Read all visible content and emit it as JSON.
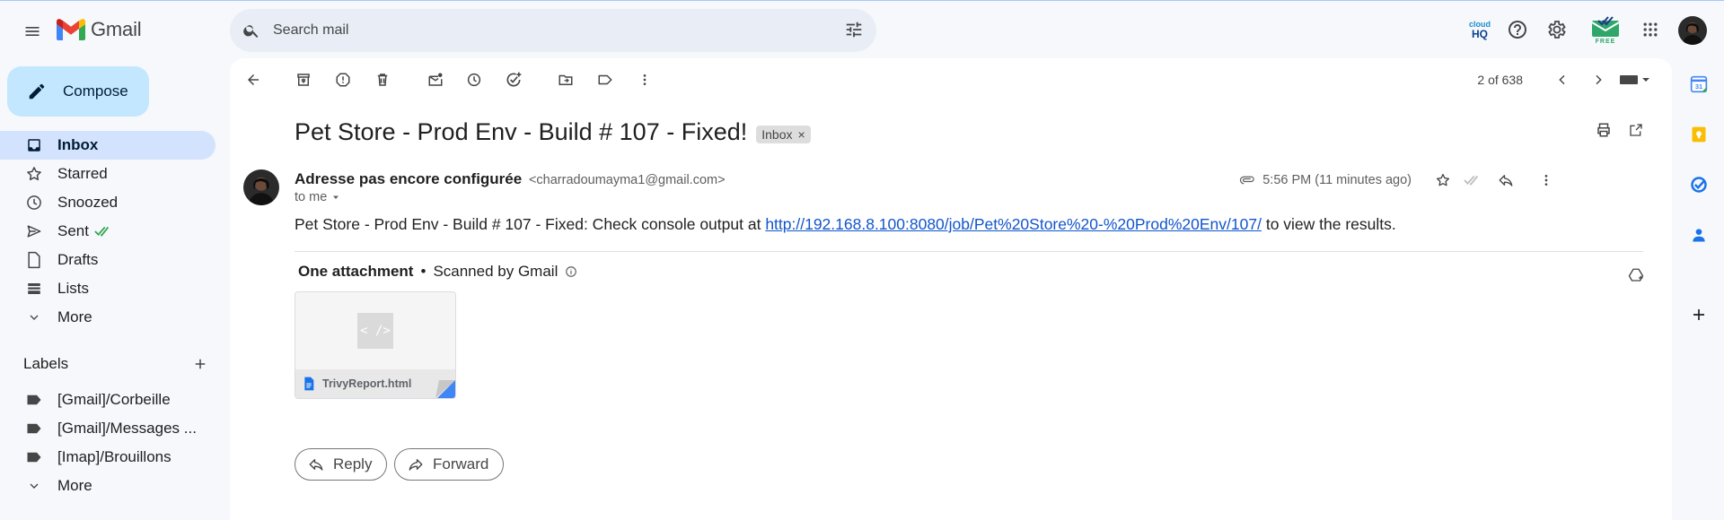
{
  "app": {
    "name": "Gmail"
  },
  "search": {
    "placeholder": "Search mail"
  },
  "header_right": {
    "addon_badge": "FREE"
  },
  "compose": {
    "label": "Compose"
  },
  "nav": {
    "items": [
      {
        "label": "Inbox",
        "icon": "inbox-icon",
        "active": true
      },
      {
        "label": "Starred",
        "icon": "star-icon"
      },
      {
        "label": "Snoozed",
        "icon": "clock-icon"
      },
      {
        "label": "Sent",
        "icon": "send-icon"
      },
      {
        "label": "Drafts",
        "icon": "draft-icon"
      },
      {
        "label": "Lists",
        "icon": "list-icon"
      },
      {
        "label": "More",
        "icon": "chevron-down-icon"
      }
    ]
  },
  "labels": {
    "heading": "Labels",
    "items": [
      {
        "label": "[Gmail]/Corbeille"
      },
      {
        "label": "[Gmail]/Messages ..."
      },
      {
        "label": "[Imap]/Brouillons"
      },
      {
        "label": "More"
      }
    ]
  },
  "toolbar": {
    "paging": "2 of 638"
  },
  "email": {
    "subject": "Pet Store - Prod Env - Build # 107 - Fixed!",
    "label_chip": "Inbox",
    "chip_close": "×",
    "sender_name": "Adresse pas encore configurée",
    "sender_email": "<charradoumayma1@gmail.com>",
    "to": "to me",
    "time": "5:56 PM (11 minutes ago)",
    "body_prefix": "Pet Store - Prod Env - Build # 107 - Fixed: Check console output at",
    "body_link": "http://192.168.8.100:8080/job/Pet%20Store%20-%20Prod%20Env/107/",
    "body_suffix": "to view the results.",
    "attachments_heading": "One attachment",
    "attachments_sep": "•",
    "scanned": "Scanned by Gmail",
    "attachment": {
      "thumb_glyph": "< />",
      "filename": "TrivyReport.html"
    }
  },
  "actions": {
    "reply": "Reply",
    "forward": "Forward"
  },
  "colors": {
    "accent": "#0b57d0",
    "compose_bg": "#c2e7ff",
    "active_nav": "#d3e3fd",
    "sent_check": "#34a853"
  }
}
